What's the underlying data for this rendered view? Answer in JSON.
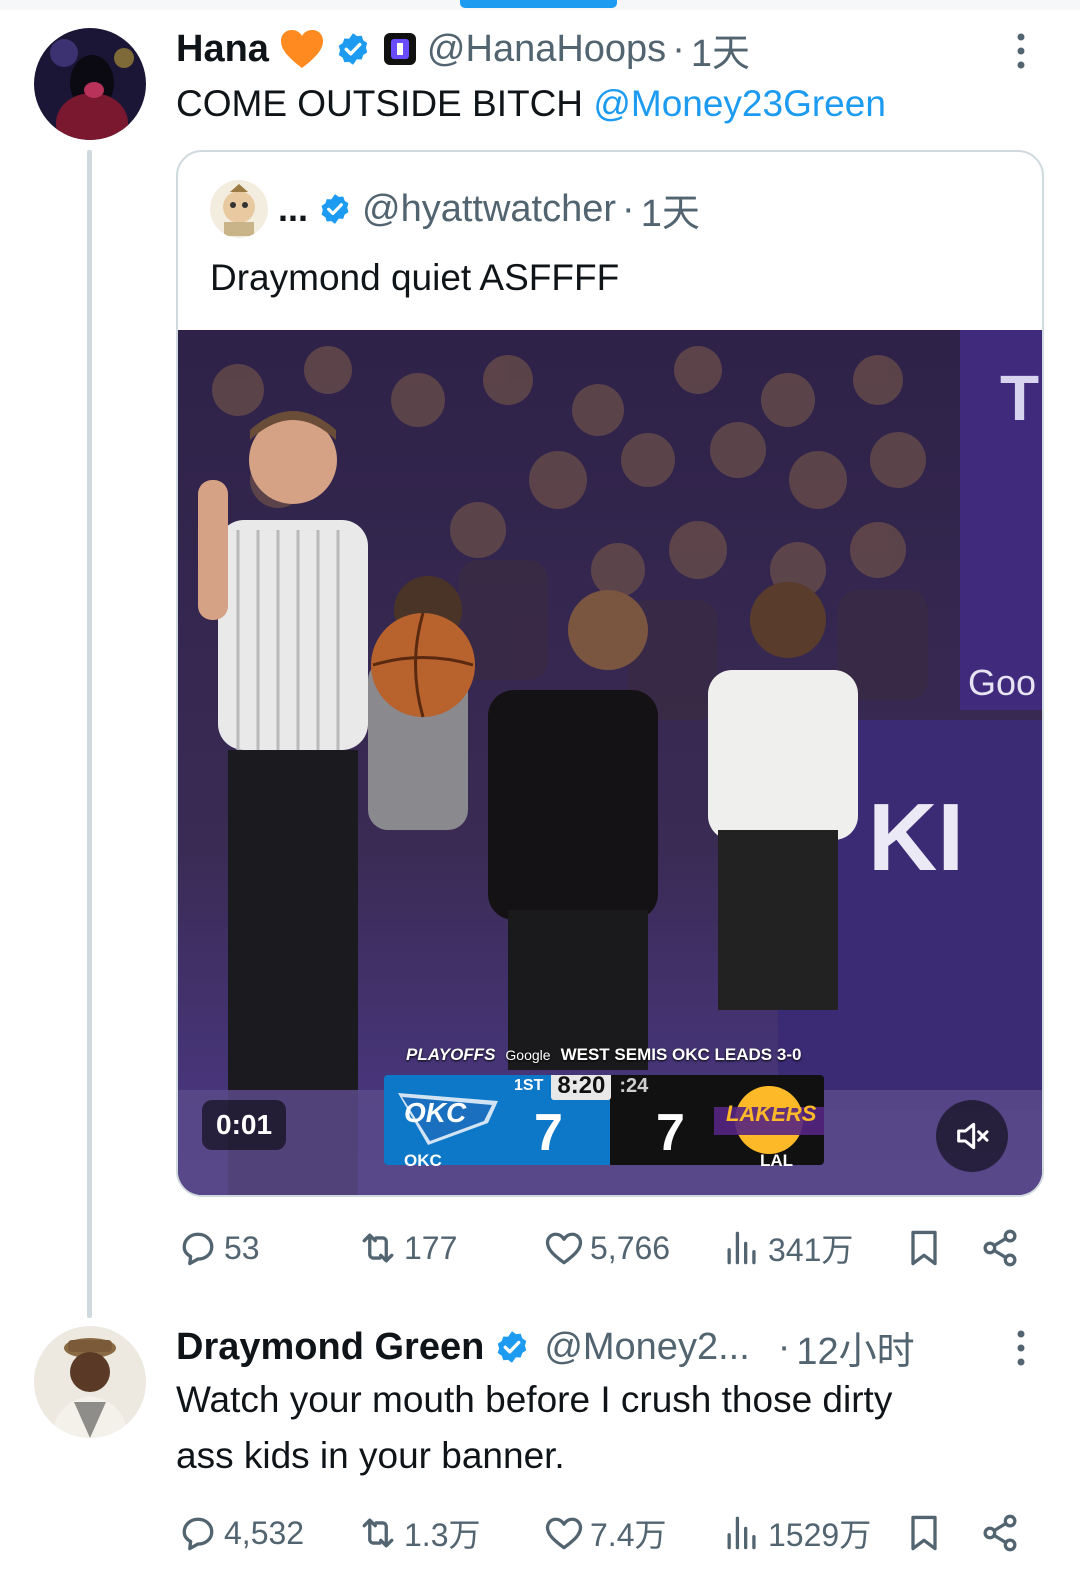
{
  "tweets": [
    {
      "name": "Hana",
      "handle": "@HanaHoops",
      "separator": "·",
      "time": "1天",
      "text": "COME OUTSIDE BITCH ",
      "mention": "@Money23Green",
      "stats": {
        "replies": "53",
        "retweets": "177",
        "likes": "5,766",
        "views": "341万"
      },
      "quote": {
        "name": "...",
        "handle": "@hyattwatcher",
        "separator": "·",
        "time": "1天",
        "text": "Draymond quiet ASFFFF",
        "video": {
          "timestamp": "0:01",
          "scoreboard": {
            "brand": "PLAYOFFS",
            "sponsor": "Google",
            "series": "WEST SEMIS  OKC LEADS 3-0",
            "quarter": "1ST",
            "clock": "8:20",
            "shot_clock": ":24",
            "home_team": "OKC",
            "away_team": "LAKERS",
            "home_abbr": "OKC",
            "away_abbr": "LAL",
            "home_score": "7",
            "away_score": "7"
          }
        }
      }
    },
    {
      "name": "Draymond Green",
      "handle": "@Money2...",
      "separator": "·",
      "time": "12小时",
      "text_line1": "Watch your mouth before I crush those dirty",
      "text_line2": "ass kids in your banner.",
      "stats": {
        "replies": "4,532",
        "retweets": "1.3万",
        "likes": "7.4万",
        "views": "1529万"
      }
    }
  ],
  "colors": {
    "accent": "#1d9bf0",
    "muted": "#536471",
    "text": "#0f1419",
    "border": "#cfd9de"
  }
}
